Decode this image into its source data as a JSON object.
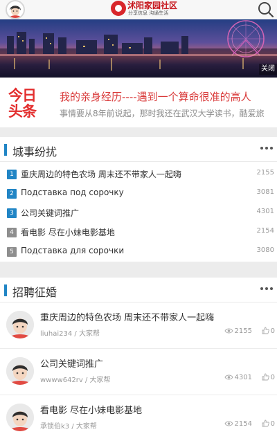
{
  "header": {
    "logo_title": "沭阳家园社区",
    "logo_slogan": "分享信息 沟通生活",
    "icons": {
      "avatar": "user-avatar-icon",
      "search": "search-icon",
      "logo": "site-logo-icon"
    }
  },
  "banner": {
    "close_label": "关闭"
  },
  "ad": {
    "logo_line1": "今日",
    "logo_line2": "头条",
    "title": "我的亲身经历----遇到一个算命很准的高人",
    "description": "事情要从8年前说起，那时我还在武汉大学读书，酷爱旅"
  },
  "city_section": {
    "title": "城事纷扰",
    "items": [
      {
        "rank": "1",
        "title": "重庆周边的特色农场 周末还不带家人一起嗨",
        "count": "2155"
      },
      {
        "rank": "2",
        "title": "Подставка под сорочку",
        "count": "3081"
      },
      {
        "rank": "3",
        "title": "公司关键词推广",
        "count": "4301"
      },
      {
        "rank": "4",
        "title": "看电影 尽在小妹电影基地",
        "count": "2154"
      },
      {
        "rank": "5",
        "title": "Подставка для сорочки",
        "count": "3080"
      }
    ]
  },
  "jobs_section": {
    "title": "招聘征婚",
    "posts": [
      {
        "title": "重庆周边的特色农场 周末还不带家人一起嗨",
        "meta": "liuhai234 / 大家帮",
        "views": "2155",
        "likes": "0"
      },
      {
        "title": "公司关键词推广",
        "meta": "wwww642rv / 大家帮",
        "views": "4301",
        "likes": "0"
      },
      {
        "title": "看电影 尽在小妹电影基地",
        "meta": "承锁伯k3 / 大家帮",
        "views": "2154",
        "likes": "0"
      }
    ]
  },
  "colors": {
    "accent": "#2185c5",
    "ad_red": "#d93939",
    "rank_top": "#2185c5",
    "rank_other": "#8e8e8e"
  }
}
